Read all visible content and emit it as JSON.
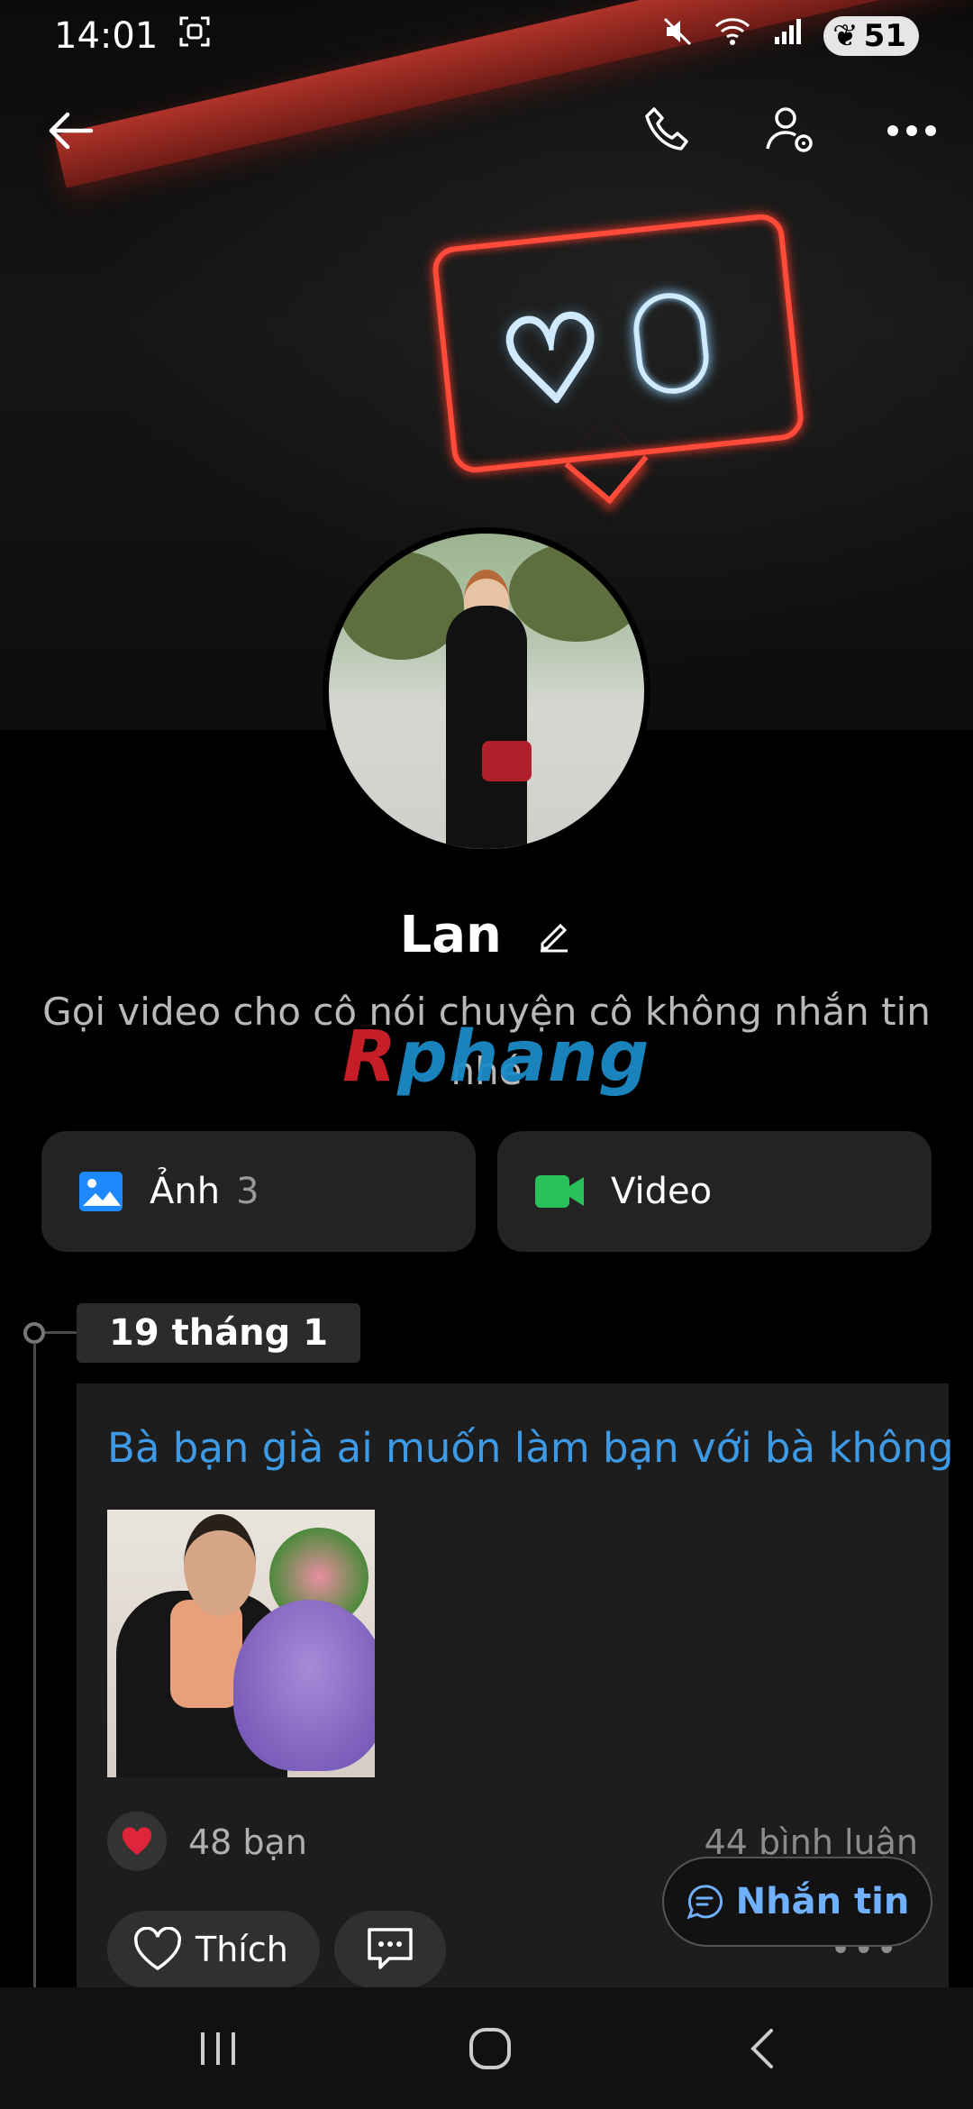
{
  "status_bar": {
    "time": "14:01",
    "battery": "51",
    "icons": [
      "screenshot-icon",
      "mute-icon",
      "wifi-icon",
      "signal-icon",
      "battery-icon"
    ]
  },
  "top_bar": {
    "icons": [
      "back-arrow-icon",
      "phone-call-icon",
      "profile-settings-icon",
      "more-options-icon"
    ]
  },
  "profile": {
    "name": "Lan",
    "bio": "Gọi video cho cô nói chuyện cô không nhắn tin nhé"
  },
  "watermark": {
    "r": "R",
    "rest": "phang"
  },
  "media": {
    "photos_label": "Ảnh",
    "photos_count": "3",
    "video_label": "Video",
    "photos_icon_color": "#1e88ff",
    "video_icon_color": "#29c15a"
  },
  "timeline": {
    "date": "19 tháng 1"
  },
  "post": {
    "title": "Bà bạn già ai muốn làm bạn với bà không",
    "likes": "48 bạn",
    "comments": "44 bình luận",
    "like_label": "Thích"
  },
  "message_button": {
    "label": "Nhắn tin"
  },
  "colors": {
    "accent_blue": "#3f9ae6",
    "heart_red": "#e0243a"
  }
}
